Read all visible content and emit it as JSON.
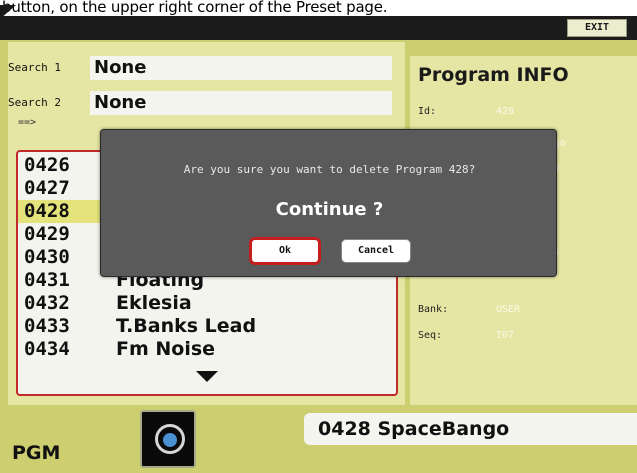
{
  "caption": "button, on the upper right corner of the Preset page.",
  "header": {
    "exit_label": "EXIT"
  },
  "search": {
    "label1": "Search 1",
    "value1": "None",
    "label2": "Search 2",
    "value2": "None",
    "arrow": "==>"
  },
  "program_list": {
    "rows": [
      {
        "num": "0426",
        "name": ""
      },
      {
        "num": "0427",
        "name": ""
      },
      {
        "num": "0428",
        "name": "",
        "selected": true
      },
      {
        "num": "0429",
        "name": ""
      },
      {
        "num": "0430",
        "name": ""
      },
      {
        "num": "0431",
        "name": "Floating"
      },
      {
        "num": "0432",
        "name": "Eklesia"
      },
      {
        "num": "0433",
        "name": "T.Banks Lead"
      },
      {
        "num": "0434",
        "name": "Fm Noise"
      }
    ]
  },
  "info": {
    "title": "Program INFO",
    "fields": [
      {
        "key": "Id:",
        "value": "428"
      },
      {
        "key": "",
        "value": "ngo"
      },
      {
        "key": "",
        "value": "ey"
      },
      {
        "key": "",
        "value": "o"
      },
      {
        "key": "",
        "value": ".1"
      },
      {
        "key": "Bank:",
        "value": "USER"
      },
      {
        "key": "Seq:",
        "value": "I07"
      }
    ]
  },
  "bottom": {
    "pgm_label": "PGM",
    "current_program": "0428 SpaceBango"
  },
  "dialog": {
    "message": "Are you sure you want to delete Program 428?",
    "question": "Continue ?",
    "ok_label": "Ok",
    "cancel_label": "Cancel"
  }
}
